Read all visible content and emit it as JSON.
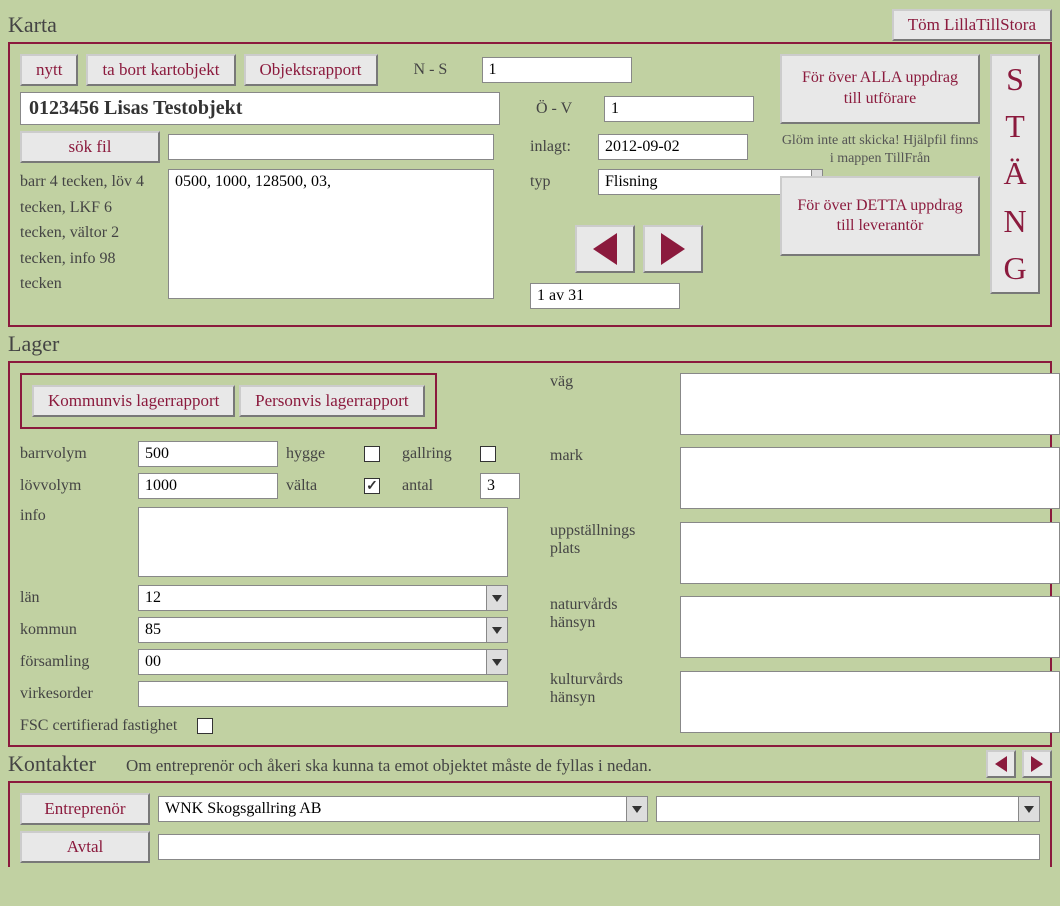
{
  "top": {
    "tom": "Töm LillaTillStora"
  },
  "karta": {
    "title": "Karta",
    "nytt": "nytt",
    "ta_bort": "ta bort kartobjekt",
    "rapport": "Objektsrapport",
    "obj_title": "0123456 Lisas Testobjekt",
    "sok_fil": "sök fil",
    "sok_val": "",
    "codes": "0500, 1000, 128500, 03,",
    "hint": "barr 4 tecken, löv 4 tecken, LKF 6 tecken, vältor 2 tecken, info 98 tecken",
    "ns_label": "N - S",
    "ns_val": "1",
    "ov_label": "Ö - V",
    "ov_val": "1",
    "inlagt_label": "inlagt:",
    "inlagt_val": "2012-09-02",
    "typ_label": "typ",
    "typ_val": "Flisning",
    "counter": "1 av 31",
    "btn_all": "För över ALLA uppdrag till utförare",
    "glom": "Glöm inte att skicka! Hjälpfil finns i mappen TillFrån",
    "btn_detta": "För över DETTA uppdrag till leverantör",
    "stang": [
      "S",
      "T",
      "Ä",
      "N",
      "G"
    ]
  },
  "lager": {
    "title": "Lager",
    "kommun_rapport": "Kommunvis lagerrapport",
    "person_rapport": "Personvis lagerrapport",
    "barrvolym_label": "barrvolym",
    "barrvolym": "500",
    "lovvolym_label": "lövvolym",
    "lovvolym": "1000",
    "hygge_label": "hygge",
    "hygge": false,
    "gallring_label": "gallring",
    "gallring": false,
    "valta_label": "välta",
    "valta": true,
    "antal_label": "antal",
    "antal": "3",
    "info_label": "info",
    "info": "",
    "lan_label": "län",
    "lan": "12",
    "kommun_label": "kommun",
    "kommun": "85",
    "forsamling_label": "församling",
    "forsamling": "00",
    "virkesorder_label": "virkesorder",
    "virkesorder": "",
    "fsc_label": "FSC certifierad fastighet",
    "fsc": false,
    "vag_label": "väg",
    "vag": "",
    "mark_label": "mark",
    "mark": "",
    "uppst_label": "uppställnings plats",
    "uppst": "",
    "naturv_label": "naturvårds hänsyn",
    "naturv": "",
    "kulturv_label": "kulturvårds hänsyn",
    "kulturv": ""
  },
  "kontakter": {
    "title": "Kontakter",
    "hint": "Om entreprenör och åkeri ska kunna ta emot objektet måste de fyllas i nedan.",
    "entreprenor_btn": "Entreprenör",
    "entreprenor_val": "WNK Skogsgallring AB",
    "entreprenor_val2": "",
    "avtal_btn": "Avtal",
    "avtal_val": ""
  }
}
